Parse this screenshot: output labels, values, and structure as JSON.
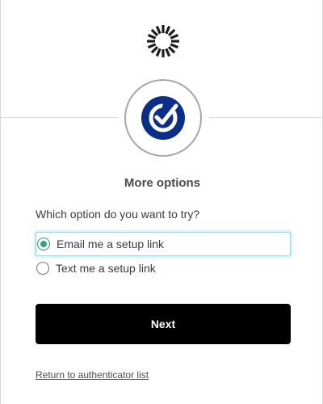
{
  "brand": {
    "logo_icon": "okta-sunburst-icon",
    "logo_color": "#1d1d21"
  },
  "factor": {
    "icon": "okta-verify-icon",
    "icon_color": "#0b2e8a"
  },
  "title": "More options",
  "question": "Which option do you want to try?",
  "options": [
    {
      "label": "Email me a setup link",
      "selected": true
    },
    {
      "label": "Text me a setup link",
      "selected": false
    }
  ],
  "next_button": {
    "label": "Next"
  },
  "return_link": {
    "label": "Return to authenticator list"
  },
  "colors": {
    "accent": "#34a17a",
    "focus": "#8fe0ef",
    "button": "#000000"
  }
}
